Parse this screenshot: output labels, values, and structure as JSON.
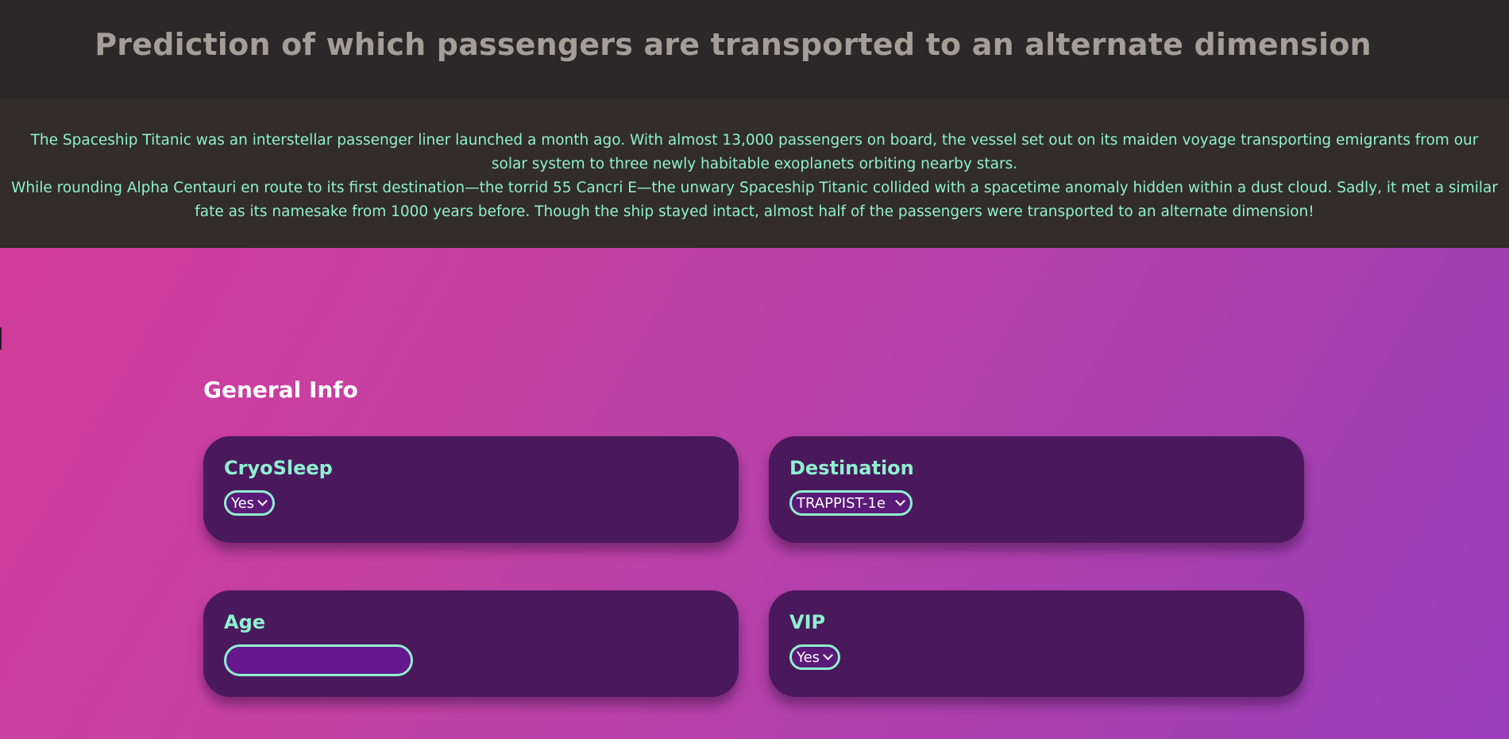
{
  "header": {
    "title": "Prediction of which passengers are transported to an alternate dimension"
  },
  "intro": {
    "paragraph_1": "The Spaceship Titanic was an interstellar passenger liner launched a month ago. With almost 13,000 passengers on board, the vessel set out on its maiden voyage transporting emigrants from our solar system to three newly habitable exoplanets orbiting nearby stars.",
    "paragraph_2": "While rounding Alpha Centauri en route to its first destination—the torrid 55 Cancri E—the unwary Spaceship Titanic collided with a spacetime anomaly hidden within a dust cloud. Sadly, it met a similar fate as its namesake from 1000 years before. Though the ship stayed intact, almost half of the passengers were transported to an alternate dimension!"
  },
  "form": {
    "section_title": "General Info",
    "cryosleep": {
      "label": "CryoSleep",
      "value": "Yes"
    },
    "destination": {
      "label": "Destination",
      "value": "TRAPPIST-1e"
    },
    "age": {
      "label": "Age",
      "value": "",
      "placeholder": ""
    },
    "vip": {
      "label": "VIP",
      "value": "Yes"
    }
  },
  "colors": {
    "accent": "#8ff0cf",
    "card": "#4a195c",
    "header": "#2a2829",
    "gradient_start": "#d43c98",
    "gradient_end": "#9a3db8"
  }
}
